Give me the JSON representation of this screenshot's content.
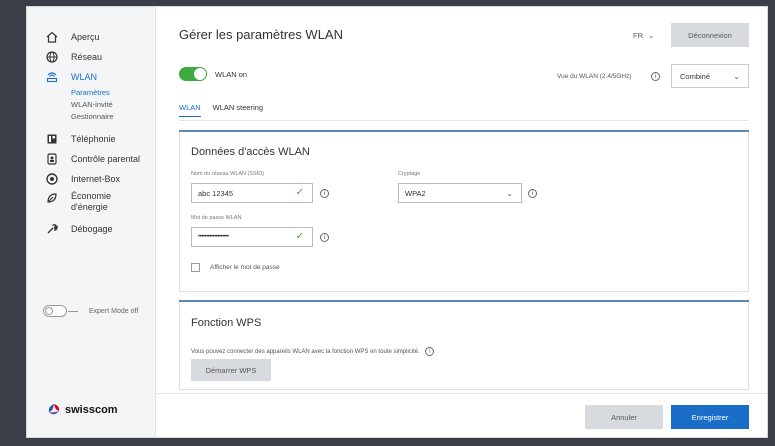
{
  "sidebar": {
    "items": [
      {
        "label": "Aperçu",
        "icon": "home-icon"
      },
      {
        "label": "Réseau",
        "icon": "globe-icon"
      },
      {
        "label": "WLAN",
        "icon": "wifi-router-icon"
      },
      {
        "label": "Téléphonie",
        "icon": "phone-icon"
      },
      {
        "label": "Contrôle parental",
        "icon": "parental-lock-icon"
      },
      {
        "label": "Internet-Box",
        "icon": "router-icon"
      },
      {
        "label": "Économie",
        "label2": "d'énergie",
        "icon": "energy-leaf-icon"
      },
      {
        "label": "Débogage",
        "icon": "wrench-icon"
      }
    ],
    "subitems": [
      {
        "label": "Paramètres"
      },
      {
        "label": "WLAN-invité"
      },
      {
        "label": "Gestionnaire"
      }
    ],
    "expert_mode_label": "Expert Mode off",
    "logo_text": "swisscom"
  },
  "header": {
    "title": "Gérer les paramètres WLAN",
    "language": "FR",
    "logout_label": "Déconnexion"
  },
  "wlan": {
    "toggle_label": "WLAN on",
    "band_label": "Vue du WLAN (2.4/5GHz)",
    "band_value": "Combiné"
  },
  "tabs": [
    {
      "label": "WLAN"
    },
    {
      "label": "WLAN steering"
    }
  ],
  "access": {
    "title": "Données d'accès WLAN",
    "ssid_label": "Nom du réseau WLAN (SSID)",
    "ssid_value": "abc 12345",
    "encryption_label": "Cryptage",
    "encryption_value": "WPA2",
    "password_label": "Mot de passe WLAN",
    "password_value": "•••••••••••••••••••",
    "show_password_label": "Afficher le mot de passe"
  },
  "wps": {
    "title": "Fonction WPS",
    "text": "Vous pouvez connecter des appareils WLAN avec la fonction WPS en toute simplicité.",
    "button_label": "Démarrer WPS"
  },
  "footer": {
    "cancel_label": "Annuler",
    "save_label": "Enregistrer"
  },
  "colors": {
    "accent": "#1a6ec8",
    "toggle_on": "#3caa3c",
    "card_topbar": "#5b84c4"
  }
}
